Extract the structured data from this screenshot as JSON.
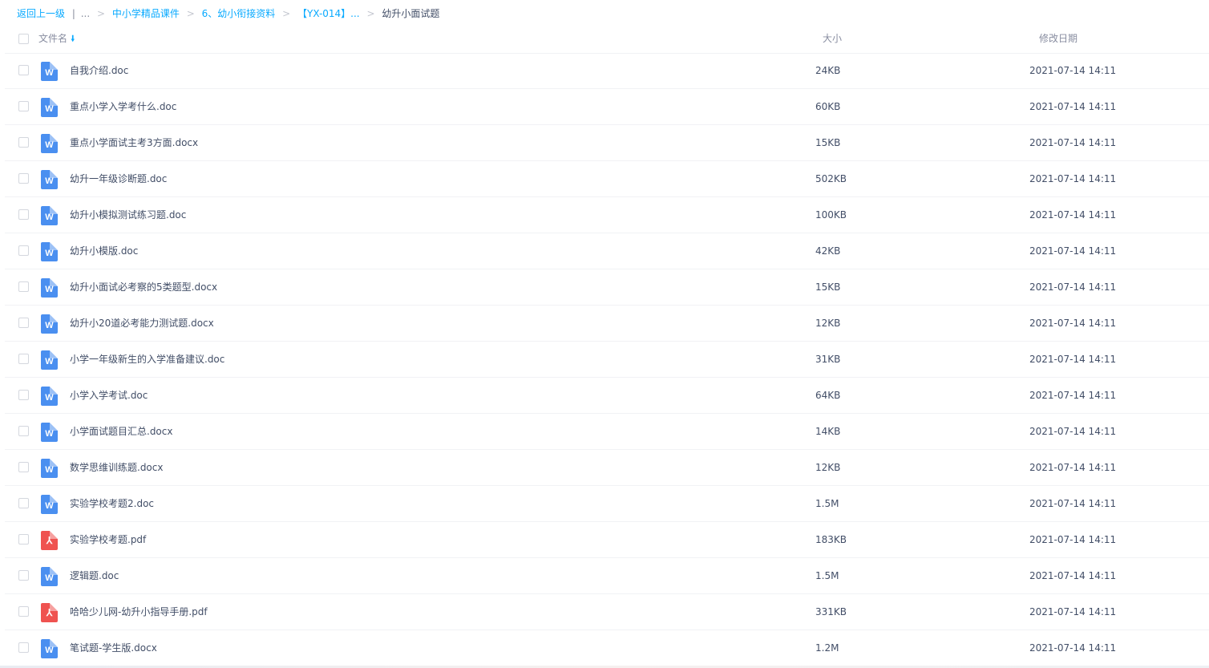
{
  "breadcrumb": {
    "back_label": "返回上一级",
    "divider": "|",
    "ellipsis": "...",
    "crumbs": [
      {
        "label": "中小学精品课件"
      },
      {
        "label": "6、幼小衔接资料"
      },
      {
        "label": "【YX-014】..."
      }
    ],
    "current": "幼升小面试题"
  },
  "table": {
    "headers": {
      "name": "文件名",
      "size": "大小",
      "date": "修改日期"
    },
    "sort_icon": "arrow-down-icon",
    "files": [
      {
        "icon": "word-file-icon",
        "glyph": "W",
        "type": "doc",
        "name": "自我介绍.doc",
        "size": "24KB",
        "date": "2021-07-14 14:11"
      },
      {
        "icon": "word-file-icon",
        "glyph": "W",
        "type": "doc",
        "name": "重点小学入学考什么.doc",
        "size": "60KB",
        "date": "2021-07-14 14:11"
      },
      {
        "icon": "word-file-icon",
        "glyph": "W",
        "type": "doc",
        "name": "重点小学面试主考3方面.docx",
        "size": "15KB",
        "date": "2021-07-14 14:11"
      },
      {
        "icon": "word-file-icon",
        "glyph": "W",
        "type": "doc",
        "name": "幼升一年级诊断题.doc",
        "size": "502KB",
        "date": "2021-07-14 14:11"
      },
      {
        "icon": "word-file-icon",
        "glyph": "W",
        "type": "doc",
        "name": "幼升小模拟测试练习题.doc",
        "size": "100KB",
        "date": "2021-07-14 14:11"
      },
      {
        "icon": "word-file-icon",
        "glyph": "W",
        "type": "doc",
        "name": "幼升小模版.doc",
        "size": "42KB",
        "date": "2021-07-14 14:11"
      },
      {
        "icon": "word-file-icon",
        "glyph": "W",
        "type": "doc",
        "name": "幼升小面试必考察的5类题型.docx",
        "size": "15KB",
        "date": "2021-07-14 14:11"
      },
      {
        "icon": "word-file-icon",
        "glyph": "W",
        "type": "doc",
        "name": "幼升小20道必考能力测试题.docx",
        "size": "12KB",
        "date": "2021-07-14 14:11"
      },
      {
        "icon": "word-file-icon",
        "glyph": "W",
        "type": "doc",
        "name": "小学一年级新生的入学准备建议.doc",
        "size": "31KB",
        "date": "2021-07-14 14:11"
      },
      {
        "icon": "word-file-icon",
        "glyph": "W",
        "type": "doc",
        "name": "小学入学考试.doc",
        "size": "64KB",
        "date": "2021-07-14 14:11"
      },
      {
        "icon": "word-file-icon",
        "glyph": "W",
        "type": "doc",
        "name": "小学面试题目汇总.docx",
        "size": "14KB",
        "date": "2021-07-14 14:11"
      },
      {
        "icon": "word-file-icon",
        "glyph": "W",
        "type": "doc",
        "name": "数学思维训练题.docx",
        "size": "12KB",
        "date": "2021-07-14 14:11"
      },
      {
        "icon": "word-file-icon",
        "glyph": "W",
        "type": "doc",
        "name": "实验学校考题2.doc",
        "size": "1.5M",
        "date": "2021-07-14 14:11"
      },
      {
        "icon": "pdf-file-icon",
        "glyph": "⅄",
        "type": "pdf",
        "name": "实验学校考题.pdf",
        "size": "183KB",
        "date": "2021-07-14 14:11"
      },
      {
        "icon": "word-file-icon",
        "glyph": "W",
        "type": "doc",
        "name": "逻辑题.doc",
        "size": "1.5M",
        "date": "2021-07-14 14:11"
      },
      {
        "icon": "pdf-file-icon",
        "glyph": "⅄",
        "type": "pdf",
        "name": "哈哈少儿网-幼升小指导手册.pdf",
        "size": "331KB",
        "date": "2021-07-14 14:11"
      },
      {
        "icon": "word-file-icon",
        "glyph": "W",
        "type": "doc",
        "name": "笔试题-学生版.docx",
        "size": "1.2M",
        "date": "2021-07-14 14:11"
      }
    ]
  },
  "colors": {
    "link": "#09aaff",
    "text": "#424e67",
    "header_text": "#888da0",
    "word_icon": "#4a8ff0",
    "pdf_icon": "#ef5350",
    "row_border": "#f1f2f5"
  }
}
